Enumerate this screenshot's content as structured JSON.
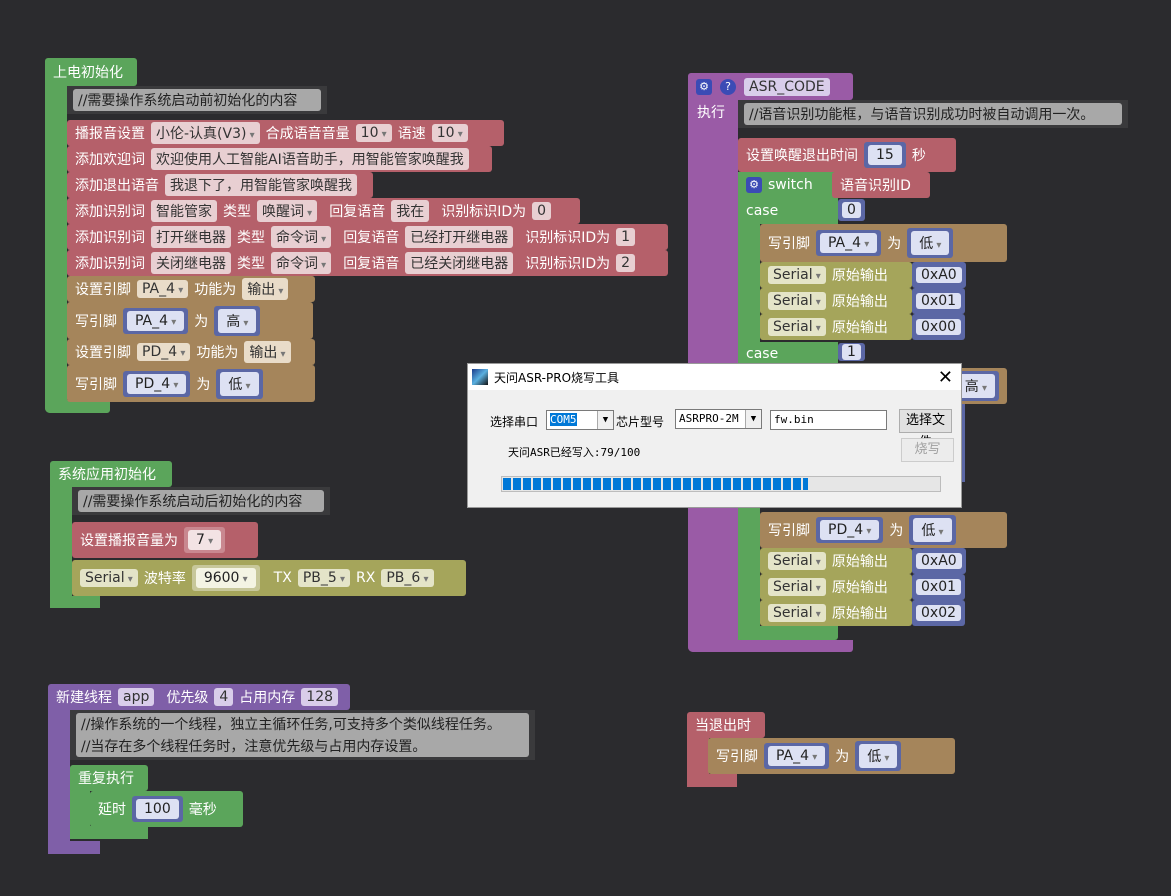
{
  "colors": {
    "background": "#2b2b2e",
    "event_green": "#5ba55b",
    "speech_red": "#b5606a",
    "pin_brown": "#a5855b",
    "serial_olive": "#a5a55b",
    "func_purple": "#9a5ba6",
    "value_blue": "#5b67a5",
    "progress_blue": "#0078d7"
  },
  "boot": {
    "title": "上电初始化",
    "comment": "//需要操作系统启动前初始化的内容",
    "voice": {
      "label": "播报音设置",
      "voice": "小伦-认真(V3)",
      "vol_label": "合成语音音量",
      "vol": "10",
      "speed_label": "语速",
      "speed": "10"
    },
    "welcome": {
      "label": "添加欢迎词",
      "text": "欢迎使用人工智能AI语音助手，用智能管家唤醒我"
    },
    "exit": {
      "label": "添加退出语音",
      "text": "我退下了，用智能管家唤醒我"
    },
    "words": [
      {
        "label": "添加识别词",
        "word": "智能管家",
        "type_label": "类型",
        "type": "唤醒词",
        "reply_label": "回复语音",
        "reply": "我在",
        "id_label": "识别标识ID为",
        "id": "0"
      },
      {
        "label": "添加识别词",
        "word": "打开继电器",
        "type_label": "类型",
        "type": "命令词",
        "reply_label": "回复语音",
        "reply": "已经打开继电器",
        "id_label": "识别标识ID为",
        "id": "1"
      },
      {
        "label": "添加识别词",
        "word": "关闭继电器",
        "type_label": "类型",
        "type": "命令词",
        "reply_label": "回复语音",
        "reply": "已经关闭继电器",
        "id_label": "识别标识ID为",
        "id": "2"
      }
    ],
    "pins": [
      {
        "label": "设置引脚",
        "pin": "PA_4",
        "func_label": "功能为",
        "func": "输出"
      },
      {
        "label": "写引脚",
        "pin": "PA_4",
        "as": "为",
        "value": "高"
      },
      {
        "label": "设置引脚",
        "pin": "PD_4",
        "func_label": "功能为",
        "func": "输出"
      },
      {
        "label": "写引脚",
        "pin": "PD_4",
        "as": "为",
        "value": "低"
      }
    ]
  },
  "sysinit": {
    "title": "系统应用初始化",
    "comment": "//需要操作系统启动后初始化的内容",
    "vol_label": "设置播报音量为",
    "vol": "7",
    "serial": "Serial",
    "baud_label": "波特率",
    "baud": "9600",
    "tx_label": "TX",
    "tx": "PB_5",
    "rx_label": "RX",
    "rx": "PB_6"
  },
  "thread": {
    "title": "新建线程",
    "name": "app",
    "prio_label": "优先级",
    "prio": "4",
    "mem_label": "占用内存",
    "mem": "128",
    "comment1": "//操作系统的一个线程，独立主循环任务,可支持多个类似线程任务。",
    "comment2": "//当存在多个线程任务时，注意优先级与占用内存设置。",
    "loop": "重复执行",
    "delay_label": "延时",
    "delay": "100",
    "delay_unit": "毫秒"
  },
  "asr": {
    "name": "ASR_CODE",
    "exec": "执行",
    "comment": "//语音识别功能框，与语音识别成功时被自动调用一次。",
    "timeout_label": "设置唤醒退出时间",
    "timeout": "15",
    "timeout_unit": "秒",
    "switch": "switch",
    "switch_var": "语音识别ID",
    "case": "case",
    "case0": "0",
    "case1": "1",
    "write0": {
      "label": "写引脚",
      "pin": "PA_4",
      "as": "为",
      "value": "低"
    },
    "write1_value": "高",
    "serial0": [
      {
        "port": "Serial",
        "label": "原始输出",
        "val": "0xA0"
      },
      {
        "port": "Serial",
        "label": "原始输出",
        "val": "0x01"
      },
      {
        "port": "Serial",
        "label": "原始输出",
        "val": "0x00"
      }
    ],
    "write2": {
      "label": "写引脚",
      "pin": "PD_4",
      "as": "为",
      "value": "低"
    },
    "serial2": [
      {
        "port": "Serial",
        "label": "原始输出",
        "val": "0xA0"
      },
      {
        "port": "Serial",
        "label": "原始输出",
        "val": "0x01"
      },
      {
        "port": "Serial",
        "label": "原始输出",
        "val": "0x02"
      }
    ]
  },
  "onexit": {
    "title": "当退出时",
    "label": "写引脚",
    "pin": "PA_4",
    "as": "为",
    "value": "低"
  },
  "dialog": {
    "title": "天问ASR-PRO烧写工具",
    "port_label": "选择串口",
    "port": "COM5",
    "chip_label": "芯片型号",
    "chip": "ASRPRO-2M",
    "file": "fw.bin",
    "choose_file": "选择文件",
    "burn": "烧写",
    "status": "天问ASR已经写入:79/100",
    "progress": 79
  }
}
